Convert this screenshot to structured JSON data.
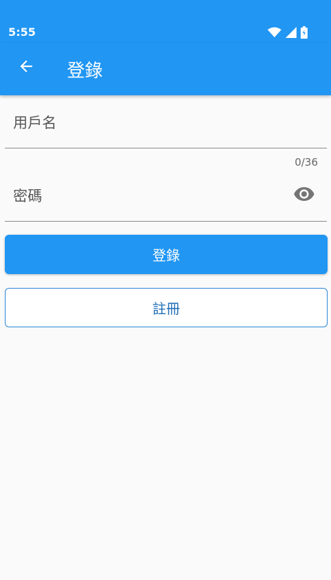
{
  "status_bar": {
    "time": "5:55"
  },
  "app_bar": {
    "title": "登錄"
  },
  "form": {
    "username_placeholder": "用戶名",
    "username_value": "",
    "password_placeholder": "密碼",
    "password_value": "",
    "counter": "0/36"
  },
  "buttons": {
    "login_label": "登錄",
    "register_label": "註冊"
  },
  "colors": {
    "primary": "#2196f3",
    "background": "#fafafa"
  },
  "icons": [
    "wifi-icon",
    "signal-icon",
    "battery-icon",
    "back-arrow-icon",
    "eye-icon"
  ]
}
